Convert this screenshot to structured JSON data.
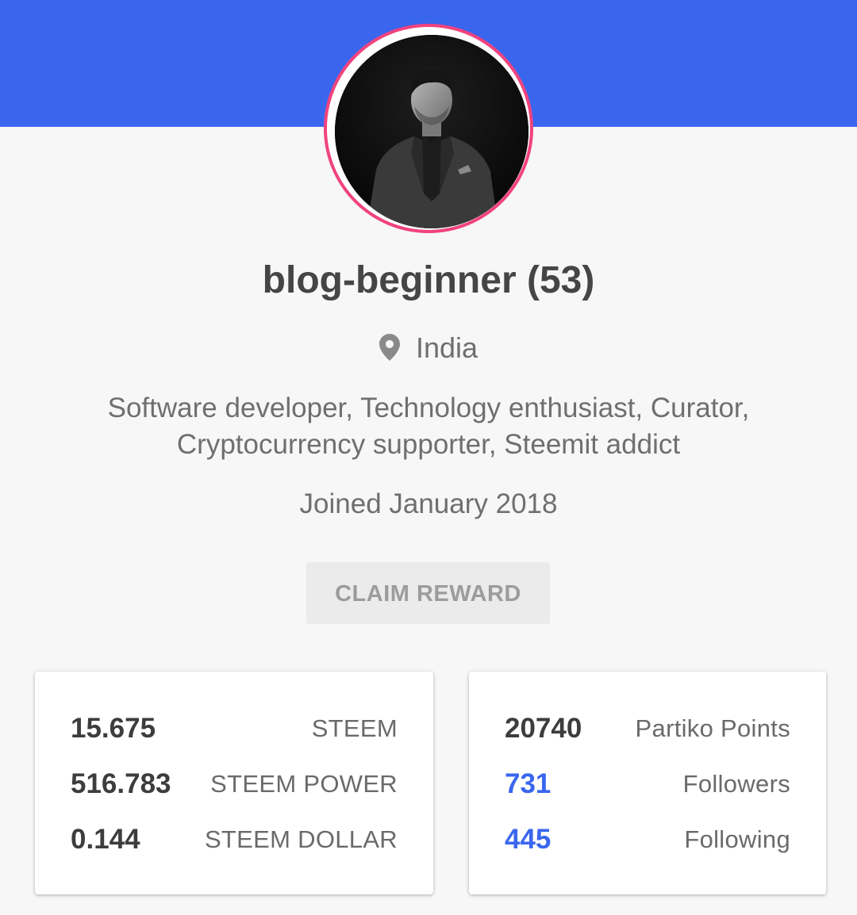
{
  "colors": {
    "header": "#3a66ee",
    "avatar_ring": "#f0437e",
    "link": "#3a66ee",
    "background": "#f7f7f7"
  },
  "profile": {
    "username": "blog-beginner (53)",
    "location_icon": "location-pin-icon",
    "location": "India",
    "bio_line1": "Software developer, Technology enthusiast, Curator,",
    "bio_line2": "Cryptocurrency supporter, Steemit addict",
    "joined": "Joined January 2018"
  },
  "actions": {
    "claim_reward": "CLAIM REWARD"
  },
  "wallet": [
    {
      "value": "15.675",
      "label": "STEEM"
    },
    {
      "value": "516.783",
      "label": "STEEM POWER"
    },
    {
      "value": "0.144",
      "label": "STEEM DOLLAR"
    }
  ],
  "social": [
    {
      "value": "20740",
      "label": "Partiko Points"
    },
    {
      "value": "731",
      "label": "Followers"
    },
    {
      "value": "445",
      "label": "Following"
    }
  ]
}
